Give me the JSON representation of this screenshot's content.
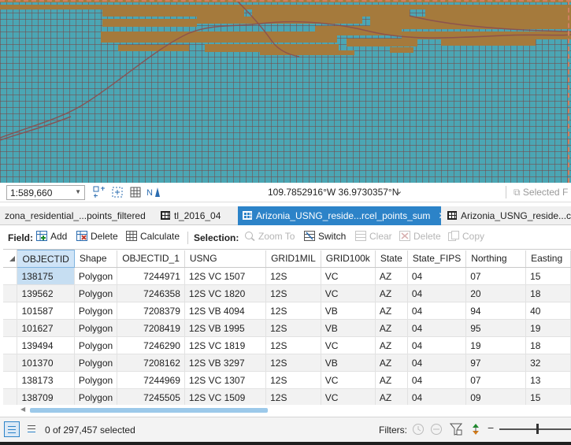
{
  "map": {
    "water_color": "#4ba6b4",
    "parcel_color": "#a57a3c",
    "road_color": "#8b4f4f"
  },
  "map_status": {
    "scale": "1:589,660",
    "coordinates": "109.7852916°W 36.9730357°N",
    "selected_features": "Selected F"
  },
  "tabs": [
    {
      "label": "zona_residential_...points_filtered",
      "icon": "none"
    },
    {
      "label": "tl_2016_04",
      "icon": "table-icon"
    },
    {
      "label": "Arizonia_USNG_reside...rcel_points_sum",
      "icon": "table-icon",
      "active": true
    },
    {
      "label": "Arizonia_USNG_reside...ce",
      "icon": "table-icon"
    }
  ],
  "toolbar": {
    "field_label": "Field:",
    "add": "Add",
    "delete": "Delete",
    "calculate": "Calculate",
    "selection_label": "Selection:",
    "zoom_to": "Zoom To",
    "switch": "Switch",
    "clear": "Clear",
    "delete_sel": "Delete",
    "copy": "Copy"
  },
  "table": {
    "columns": [
      "OBJECTID",
      "Shape",
      "OBJECTID_1",
      "USNG",
      "GRID1MIL",
      "GRID100k",
      "State",
      "State_FIPS",
      "Northing",
      "Easting"
    ],
    "rows": [
      [
        "138175",
        "Polygon",
        "7244971",
        "12S VC 1507",
        "12S",
        "VC",
        "AZ",
        "04",
        "07",
        "15"
      ],
      [
        "139562",
        "Polygon",
        "7246358",
        "12S VC 1820",
        "12S",
        "VC",
        "AZ",
        "04",
        "20",
        "18"
      ],
      [
        "101587",
        "Polygon",
        "7208379",
        "12S VB 4094",
        "12S",
        "VB",
        "AZ",
        "04",
        "94",
        "40"
      ],
      [
        "101627",
        "Polygon",
        "7208419",
        "12S VB 1995",
        "12S",
        "VB",
        "AZ",
        "04",
        "95",
        "19"
      ],
      [
        "139494",
        "Polygon",
        "7246290",
        "12S VC 1819",
        "12S",
        "VC",
        "AZ",
        "04",
        "19",
        "18"
      ],
      [
        "101370",
        "Polygon",
        "7208162",
        "12S VB 3297",
        "12S",
        "VB",
        "AZ",
        "04",
        "97",
        "32"
      ],
      [
        "138173",
        "Polygon",
        "7244969",
        "12S VC 1307",
        "12S",
        "VC",
        "AZ",
        "04",
        "07",
        "13"
      ],
      [
        "138709",
        "Polygon",
        "7245505",
        "12S VC 1509",
        "12S",
        "VC",
        "AZ",
        "04",
        "09",
        "15"
      ]
    ]
  },
  "status": {
    "selection_count": "0 of 297,457 selected",
    "filters_label": "Filters:"
  }
}
